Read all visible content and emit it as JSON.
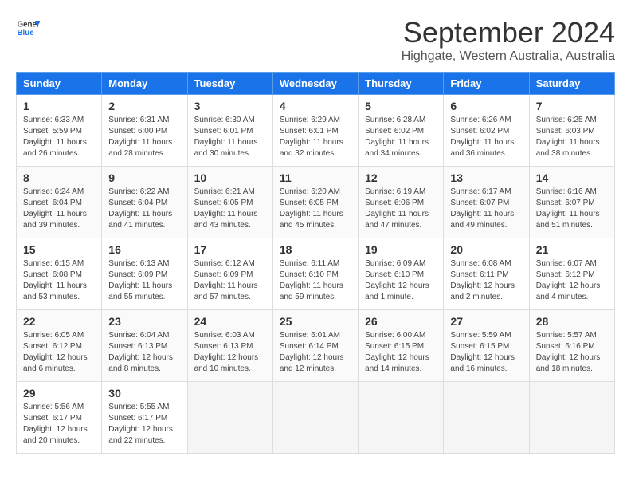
{
  "header": {
    "logo_general": "General",
    "logo_blue": "Blue",
    "month_title": "September 2024",
    "location": "Highgate, Western Australia, Australia"
  },
  "days_of_week": [
    "Sunday",
    "Monday",
    "Tuesday",
    "Wednesday",
    "Thursday",
    "Friday",
    "Saturday"
  ],
  "weeks": [
    [
      {
        "day": "1",
        "sunrise": "6:33 AM",
        "sunset": "5:59 PM",
        "daylight": "11 hours and 26 minutes."
      },
      {
        "day": "2",
        "sunrise": "6:31 AM",
        "sunset": "6:00 PM",
        "daylight": "11 hours and 28 minutes."
      },
      {
        "day": "3",
        "sunrise": "6:30 AM",
        "sunset": "6:01 PM",
        "daylight": "11 hours and 30 minutes."
      },
      {
        "day": "4",
        "sunrise": "6:29 AM",
        "sunset": "6:01 PM",
        "daylight": "11 hours and 32 minutes."
      },
      {
        "day": "5",
        "sunrise": "6:28 AM",
        "sunset": "6:02 PM",
        "daylight": "11 hours and 34 minutes."
      },
      {
        "day": "6",
        "sunrise": "6:26 AM",
        "sunset": "6:02 PM",
        "daylight": "11 hours and 36 minutes."
      },
      {
        "day": "7",
        "sunrise": "6:25 AM",
        "sunset": "6:03 PM",
        "daylight": "11 hours and 38 minutes."
      }
    ],
    [
      {
        "day": "8",
        "sunrise": "6:24 AM",
        "sunset": "6:04 PM",
        "daylight": "11 hours and 39 minutes."
      },
      {
        "day": "9",
        "sunrise": "6:22 AM",
        "sunset": "6:04 PM",
        "daylight": "11 hours and 41 minutes."
      },
      {
        "day": "10",
        "sunrise": "6:21 AM",
        "sunset": "6:05 PM",
        "daylight": "11 hours and 43 minutes."
      },
      {
        "day": "11",
        "sunrise": "6:20 AM",
        "sunset": "6:05 PM",
        "daylight": "11 hours and 45 minutes."
      },
      {
        "day": "12",
        "sunrise": "6:19 AM",
        "sunset": "6:06 PM",
        "daylight": "11 hours and 47 minutes."
      },
      {
        "day": "13",
        "sunrise": "6:17 AM",
        "sunset": "6:07 PM",
        "daylight": "11 hours and 49 minutes."
      },
      {
        "day": "14",
        "sunrise": "6:16 AM",
        "sunset": "6:07 PM",
        "daylight": "11 hours and 51 minutes."
      }
    ],
    [
      {
        "day": "15",
        "sunrise": "6:15 AM",
        "sunset": "6:08 PM",
        "daylight": "11 hours and 53 minutes."
      },
      {
        "day": "16",
        "sunrise": "6:13 AM",
        "sunset": "6:09 PM",
        "daylight": "11 hours and 55 minutes."
      },
      {
        "day": "17",
        "sunrise": "6:12 AM",
        "sunset": "6:09 PM",
        "daylight": "11 hours and 57 minutes."
      },
      {
        "day": "18",
        "sunrise": "6:11 AM",
        "sunset": "6:10 PM",
        "daylight": "11 hours and 59 minutes."
      },
      {
        "day": "19",
        "sunrise": "6:09 AM",
        "sunset": "6:10 PM",
        "daylight": "12 hours and 1 minute."
      },
      {
        "day": "20",
        "sunrise": "6:08 AM",
        "sunset": "6:11 PM",
        "daylight": "12 hours and 2 minutes."
      },
      {
        "day": "21",
        "sunrise": "6:07 AM",
        "sunset": "6:12 PM",
        "daylight": "12 hours and 4 minutes."
      }
    ],
    [
      {
        "day": "22",
        "sunrise": "6:05 AM",
        "sunset": "6:12 PM",
        "daylight": "12 hours and 6 minutes."
      },
      {
        "day": "23",
        "sunrise": "6:04 AM",
        "sunset": "6:13 PM",
        "daylight": "12 hours and 8 minutes."
      },
      {
        "day": "24",
        "sunrise": "6:03 AM",
        "sunset": "6:13 PM",
        "daylight": "12 hours and 10 minutes."
      },
      {
        "day": "25",
        "sunrise": "6:01 AM",
        "sunset": "6:14 PM",
        "daylight": "12 hours and 12 minutes."
      },
      {
        "day": "26",
        "sunrise": "6:00 AM",
        "sunset": "6:15 PM",
        "daylight": "12 hours and 14 minutes."
      },
      {
        "day": "27",
        "sunrise": "5:59 AM",
        "sunset": "6:15 PM",
        "daylight": "12 hours and 16 minutes."
      },
      {
        "day": "28",
        "sunrise": "5:57 AM",
        "sunset": "6:16 PM",
        "daylight": "12 hours and 18 minutes."
      }
    ],
    [
      {
        "day": "29",
        "sunrise": "5:56 AM",
        "sunset": "6:17 PM",
        "daylight": "12 hours and 20 minutes."
      },
      {
        "day": "30",
        "sunrise": "5:55 AM",
        "sunset": "6:17 PM",
        "daylight": "12 hours and 22 minutes."
      },
      null,
      null,
      null,
      null,
      null
    ]
  ]
}
